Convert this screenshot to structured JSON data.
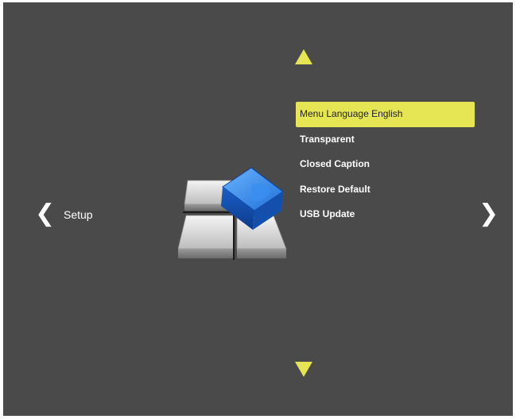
{
  "section": {
    "label": "Setup"
  },
  "menu": {
    "items": [
      {
        "label": "Menu Language English",
        "selected": true
      },
      {
        "label": "Transparent",
        "selected": false
      },
      {
        "label": "Closed Caption",
        "selected": false
      },
      {
        "label": "Restore Default",
        "selected": false
      },
      {
        "label": "USB Update",
        "selected": false
      }
    ]
  },
  "icons": {
    "scroll_up": "triangle-up-icon",
    "scroll_down": "triangle-down-icon",
    "prev": "chevron-left-icon",
    "next": "chevron-right-icon",
    "setup": "setup-tool-icon"
  },
  "colors": {
    "background": "#4a4a4a",
    "accent": "#e6e654",
    "text": "#ffffff",
    "selected_text": "#222222"
  }
}
